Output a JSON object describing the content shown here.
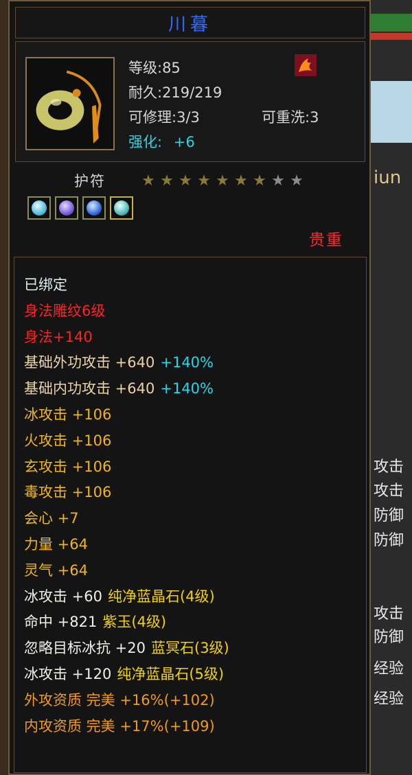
{
  "item": {
    "name": "川暮",
    "level_label": "等级:85",
    "durability_label": "耐久:219/219",
    "repair_label": "可修理:3/3",
    "rewash_label": "可重洗:3",
    "enhance_label": "强化:",
    "enhance_value": "+6",
    "type_label": "护符",
    "stars_filled": 7,
    "stars_total": 9,
    "rarity": "贵重",
    "gems": [
      "cyan-gem",
      "purple-gem",
      "blue-gem",
      "teal-gem"
    ]
  },
  "attributes": [
    {
      "main": "已绑定",
      "extra": "",
      "color": "white",
      "extra_color": ""
    },
    {
      "main": "身法雕纹6级",
      "extra": "",
      "color": "red",
      "extra_color": ""
    },
    {
      "main": "身法+140",
      "extra": "",
      "color": "red",
      "extra_color": ""
    },
    {
      "main": "基础外功攻击 +640",
      "extra": "+140%",
      "color": "tan",
      "extra_color": "teal"
    },
    {
      "main": "基础内功攻击 +640",
      "extra": "+140%",
      "color": "tan",
      "extra_color": "teal"
    },
    {
      "main": "冰攻击 +106",
      "extra": "",
      "color": "gold",
      "extra_color": ""
    },
    {
      "main": "火攻击 +106",
      "extra": "",
      "color": "gold",
      "extra_color": ""
    },
    {
      "main": "玄攻击 +106",
      "extra": "",
      "color": "gold",
      "extra_color": ""
    },
    {
      "main": "毒攻击 +106",
      "extra": "",
      "color": "gold",
      "extra_color": ""
    },
    {
      "main": "会心 +7",
      "extra": "",
      "color": "gold",
      "extra_color": ""
    },
    {
      "main": "力量 +64",
      "extra": "",
      "color": "gold",
      "extra_color": ""
    },
    {
      "main": "灵气 +64",
      "extra": "",
      "color": "gold",
      "extra_color": ""
    },
    {
      "main": "冰攻击 +60",
      "extra": "纯净蓝晶石(4级)",
      "color": "light",
      "extra_color": "yellow"
    },
    {
      "main": "命中 +821",
      "extra": "紫玉(4级)",
      "color": "light",
      "extra_color": "yellow"
    },
    {
      "main": "忽略目标冰抗 +20",
      "extra": "蓝冥石(3级)",
      "color": "light",
      "extra_color": "yellow"
    },
    {
      "main": "冰攻击 +120",
      "extra": "纯净蓝晶石(5级)",
      "color": "light",
      "extra_color": "yellow"
    },
    {
      "main": "外攻资质  完美 +16%(+102)",
      "extra": "",
      "color": "orange",
      "extra_color": ""
    },
    {
      "main": "内攻资质  完美 +17%(+109)",
      "extra": "",
      "color": "orange",
      "extra_color": ""
    }
  ],
  "background_panel": {
    "partial_label": "iun",
    "labels": [
      "攻击",
      "攻击",
      "防御",
      "防御",
      "攻击",
      "防御",
      "经验",
      "经验"
    ],
    "colors": {
      "accent_red": "#c0392b",
      "accent_green": "#2e7d32"
    }
  }
}
